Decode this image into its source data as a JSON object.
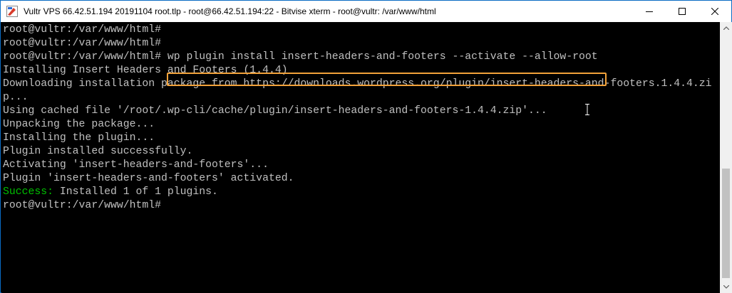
{
  "window": {
    "title": "Vultr VPS 66.42.51.194 20191104 root.tlp - root@66.42.51.194:22 - Bitvise xterm - root@vultr: /var/www/html",
    "icons": {
      "app": "bitvise-app-icon",
      "minimize": "minimize-icon",
      "maximize": "maximize-icon",
      "close": "close-icon"
    },
    "colors": {
      "titlebar": "#ffffff",
      "terminal_bg": "#000000",
      "text": "#c0c0c0",
      "success": "#00c000",
      "highlight": "#f2a23a"
    }
  },
  "terminal": {
    "lines": [
      {
        "text": "root@vultr:/var/www/html#"
      },
      {
        "text": "root@vultr:/var/www/html#"
      },
      {
        "prompt": "root@vultr:/var/www/html# ",
        "command": "wp plugin install insert-headers-and-footers --activate --allow-root"
      },
      {
        "text": "Installing Insert Headers and Footers (1.4.4)"
      },
      {
        "text": "Downloading installation package from https://downloads.wordpress.org/plugin/insert-headers-and-footers.1.4.4.zi"
      },
      {
        "text": "p..."
      },
      {
        "text": "Using cached file '/root/.wp-cli/cache/plugin/insert-headers-and-footers-1.4.4.zip'..."
      },
      {
        "text": "Unpacking the package..."
      },
      {
        "text": "Installing the plugin..."
      },
      {
        "text": "Plugin installed successfully."
      },
      {
        "text": "Activating 'insert-headers-and-footers'..."
      },
      {
        "text": "Plugin 'insert-headers-and-footers' activated."
      },
      {
        "status": "Success:",
        "text": " Installed 1 of 1 plugins."
      },
      {
        "text": "root@vultr:/var/www/html#"
      }
    ]
  }
}
